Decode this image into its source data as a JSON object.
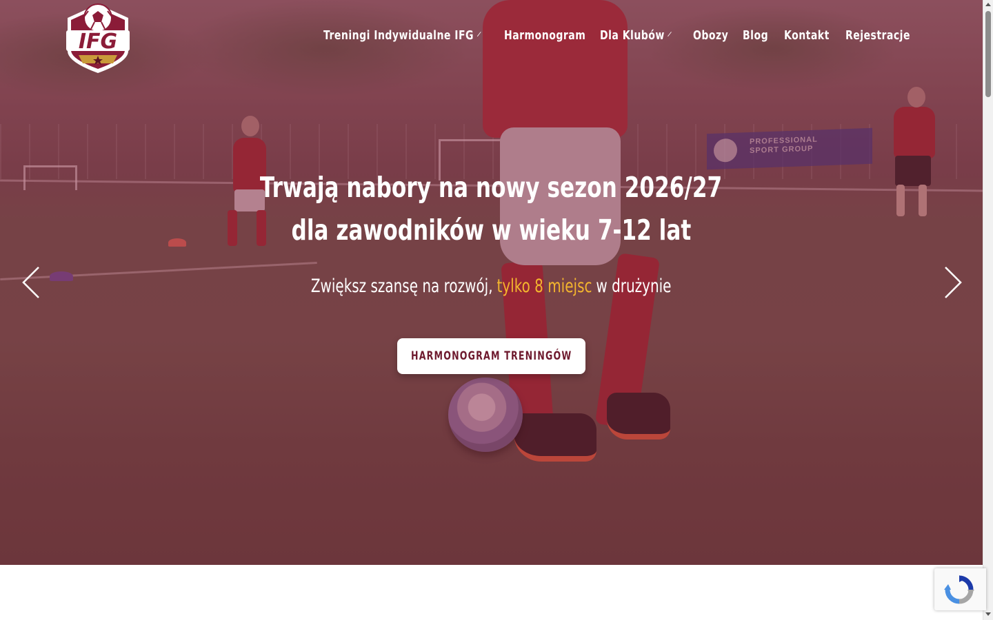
{
  "brand": {
    "logo_text": "IFG"
  },
  "nav": {
    "items": [
      {
        "label": "Treningi Indywidualne IFG",
        "has_dropdown": true
      },
      {
        "label": "Harmonogram",
        "has_dropdown": false
      },
      {
        "label": "Dla Klubów",
        "has_dropdown": true
      },
      {
        "label": "Obozy",
        "has_dropdown": false
      },
      {
        "label": "Blog",
        "has_dropdown": false
      },
      {
        "label": "Kontakt",
        "has_dropdown": false
      },
      {
        "label": "Rejestracje",
        "has_dropdown": false
      }
    ]
  },
  "hero": {
    "headline_line1": "Trwają nabory na nowy sezon 2026/27",
    "headline_line2": "dla zawodników w wieku 7-12 lat",
    "sub_before": "Zwiększ szansę na rozwój,",
    "sub_highlight": "tylko 8 miejsc",
    "sub_after": "w drużynie",
    "cta_label": "HARMONOGRAM TRENINGÓW",
    "banner_text_line1": "PROFESSIONAL",
    "banner_text_line2": "SPORT GROUP"
  },
  "colors": {
    "overlay": "#8b1c38",
    "highlight": "#f3b52e",
    "cta_text": "#6e1a2e",
    "logo_primary": "#8b1c38",
    "logo_accent": "#c99a3a"
  },
  "icons": {
    "prev": "chevron-left-icon",
    "next": "chevron-right-icon",
    "dropdown": "chevron-down-icon",
    "recaptcha": "recaptcha-icon"
  }
}
